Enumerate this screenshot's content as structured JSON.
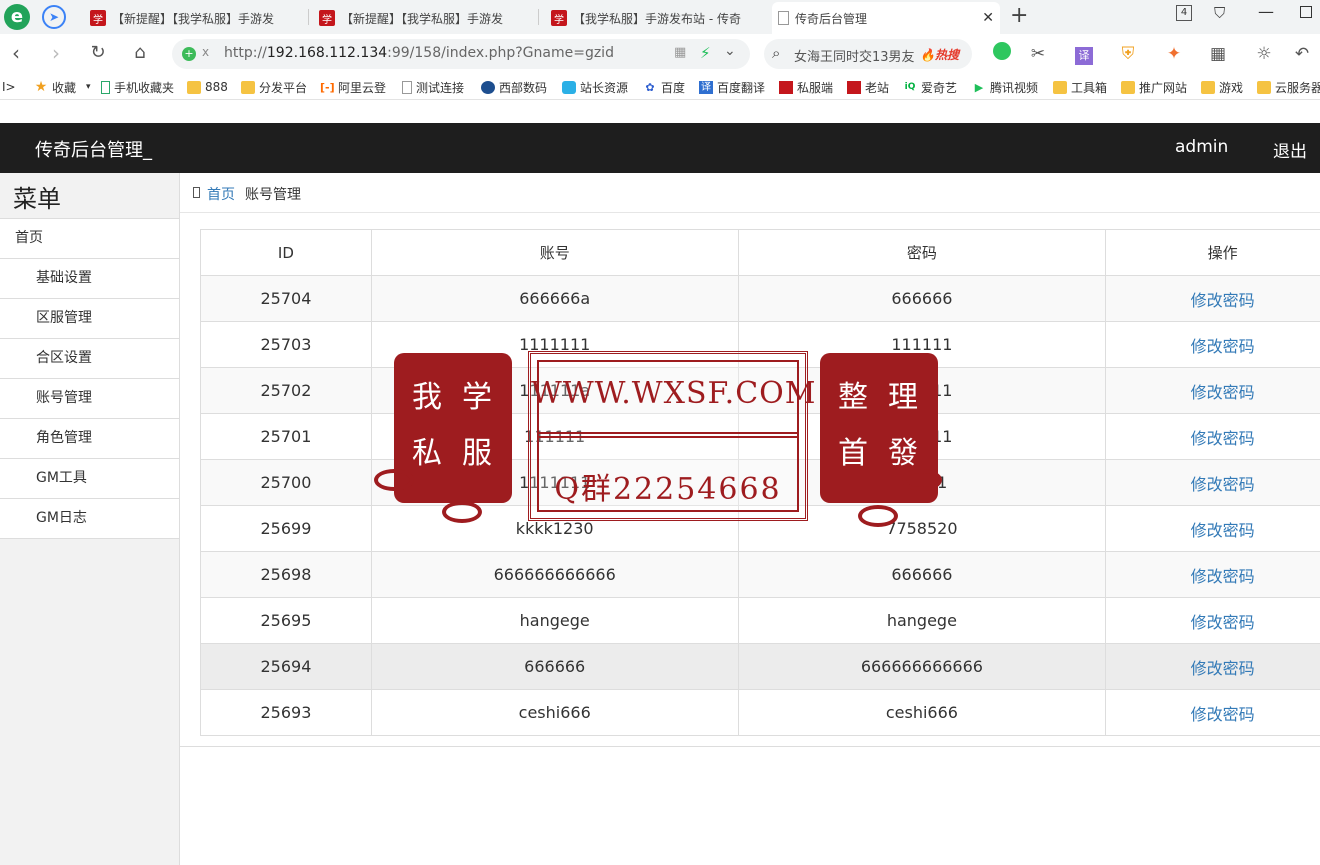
{
  "browser": {
    "tabs": [
      {
        "label": "【新提醒】【我学私服】手游发",
        "icon": "site-favicon"
      },
      {
        "label": "【新提醒】【我学私服】手游发",
        "icon": "site-favicon"
      },
      {
        "label": "【我学私服】手游发布站 - 传奇",
        "icon": "site-favicon"
      },
      {
        "label": "传奇后台管理",
        "icon": "page-icon"
      }
    ],
    "new_tab": "+",
    "tab_count": "4",
    "url_prefix": "http://",
    "url_host": "192.168.112.134",
    "url_rest": ":99/158/index.php?Gname=gzid",
    "search_text": "女海王同时交13男友",
    "search_hot": "🔥热搜",
    "bookmarks": [
      {
        "label": "收藏",
        "icon": "star-icon"
      },
      {
        "label": "手机收藏夹",
        "icon": "phone-icon"
      },
      {
        "label": "888",
        "icon": "folder-icon"
      },
      {
        "label": "分发平台",
        "icon": "folder-icon"
      },
      {
        "label": "阿里云登",
        "icon": "aliyun-icon"
      },
      {
        "label": "测试连接",
        "icon": "page-icon"
      },
      {
        "label": "西部数码",
        "icon": "site-icon"
      },
      {
        "label": "站长资源",
        "icon": "site-icon"
      },
      {
        "label": "百度",
        "icon": "baidu-icon"
      },
      {
        "label": "百度翻译",
        "icon": "translate-icon"
      },
      {
        "label": "私服端",
        "icon": "site-favicon"
      },
      {
        "label": "老站",
        "icon": "site-favicon"
      },
      {
        "label": "爱奇艺",
        "icon": "iqiyi-icon"
      },
      {
        "label": "腾讯视频",
        "icon": "video-icon"
      },
      {
        "label": "工具箱",
        "icon": "folder-icon"
      },
      {
        "label": "推广网站",
        "icon": "folder-icon"
      },
      {
        "label": "游戏",
        "icon": "folder-icon"
      },
      {
        "label": "云服务器",
        "icon": "folder-icon"
      }
    ]
  },
  "header": {
    "brand": "传奇后台管理_",
    "user": "admin",
    "logout": "退出"
  },
  "sidebar": {
    "title": "菜单",
    "items": [
      {
        "label": "首页",
        "indent": false
      },
      {
        "label": "基础设置",
        "indent": true
      },
      {
        "label": "区服管理",
        "indent": true
      },
      {
        "label": "合区设置",
        "indent": true
      },
      {
        "label": "账号管理",
        "indent": true
      },
      {
        "label": "角色管理",
        "indent": true
      },
      {
        "label": "GM工具",
        "indent": true
      },
      {
        "label": "GM日志",
        "indent": true
      }
    ]
  },
  "breadcrumb": {
    "home": "首页",
    "current": "账号管理"
  },
  "table": {
    "headers": [
      "ID",
      "账号",
      "密码",
      "操作"
    ],
    "rows": [
      {
        "id": "25704",
        "account": "666666a",
        "password": "666666",
        "action": "修改密码"
      },
      {
        "id": "25703",
        "account": "1111111",
        "password": "111111",
        "action": "修改密码"
      },
      {
        "id": "25702",
        "account": "111111a",
        "password": "111111",
        "action": "修改密码"
      },
      {
        "id": "25701",
        "account": "111111",
        "password": "111111",
        "action": "修改密码"
      },
      {
        "id": "25700",
        "account": "1111111",
        "password": "11111",
        "action": "修改密码"
      },
      {
        "id": "25699",
        "account": "kkkk1230",
        "password": "7758520",
        "action": "修改密码"
      },
      {
        "id": "25698",
        "account": "666666666666",
        "password": "666666",
        "action": "修改密码"
      },
      {
        "id": "25695",
        "account": "hangege",
        "password": "hangege",
        "action": "修改密码"
      },
      {
        "id": "25694",
        "account": "666666",
        "password": "666666666666",
        "action": "修改密码"
      },
      {
        "id": "25693",
        "account": "ceshi666",
        "password": "ceshi666",
        "action": "修改密码"
      }
    ]
  },
  "watermark": {
    "site": "WWW.WXSF.COM",
    "qq": "Q群22254668",
    "left_seal": [
      "我",
      "学",
      "私",
      "服"
    ],
    "right_seal": [
      "整",
      "理",
      "首",
      "發"
    ]
  },
  "colors": {
    "header_bg": "#1e1e1e",
    "link": "#337ab7",
    "seal_red": "#9e1c1f"
  }
}
